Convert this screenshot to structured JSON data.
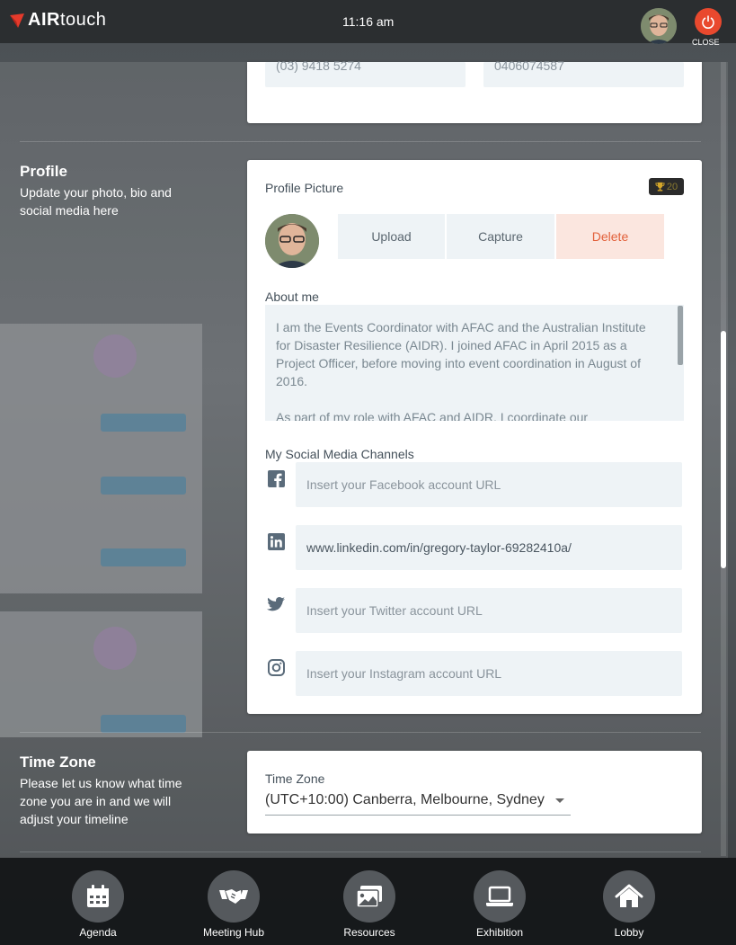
{
  "header": {
    "logo_bold": "AIR",
    "logo_thin": "touch",
    "time": "11:16 am",
    "close_label": "CLOSE"
  },
  "contact": {
    "phone": "(03) 9418 5274",
    "mobile": "0406074587"
  },
  "profile": {
    "title": "Profile",
    "description": "Update your photo, bio and social media here",
    "picture_label": "Profile Picture",
    "badge_points": "20",
    "upload_label": "Upload",
    "capture_label": "Capture",
    "delete_label": "Delete",
    "about_label": "About me",
    "about_p1": "I am the Events Coordinator with AFAC and the Australian Institute for Disaster Resilience (AIDR). I joined AFAC in April 2015 as a Project Officer, before moving into event coordination in August of 2016.",
    "about_p2": "As part of my role with AFAC and AIDR, I coordinate our",
    "social_label": "My Social Media Channels",
    "facebook_placeholder": "Insert your Facebook account URL",
    "linkedin_value": "www.linkedin.com/in/gregory-taylor-69282410a/",
    "twitter_placeholder": "Insert your Twitter account URL",
    "instagram_placeholder": "Insert your Instagram account URL"
  },
  "timezone": {
    "title": "Time Zone",
    "description": "Please let us know what time zone you are in and we will adjust your timeline",
    "field_label": "Time Zone",
    "selected": "(UTC+10:00) Canberra, Melbourne, Sydney"
  },
  "nav": [
    {
      "label": "Agenda",
      "icon": "calendar-icon"
    },
    {
      "label": "Meeting Hub",
      "icon": "handshake-icon"
    },
    {
      "label": "Resources",
      "icon": "images-icon"
    },
    {
      "label": "Exhibition",
      "icon": "laptop-icon"
    },
    {
      "label": "Lobby",
      "icon": "home-icon"
    }
  ],
  "colors": {
    "close": "#e9492e",
    "delete_bg": "#fbe6df",
    "delete_text": "#e2603a",
    "field_bg": "#eef3f6"
  }
}
